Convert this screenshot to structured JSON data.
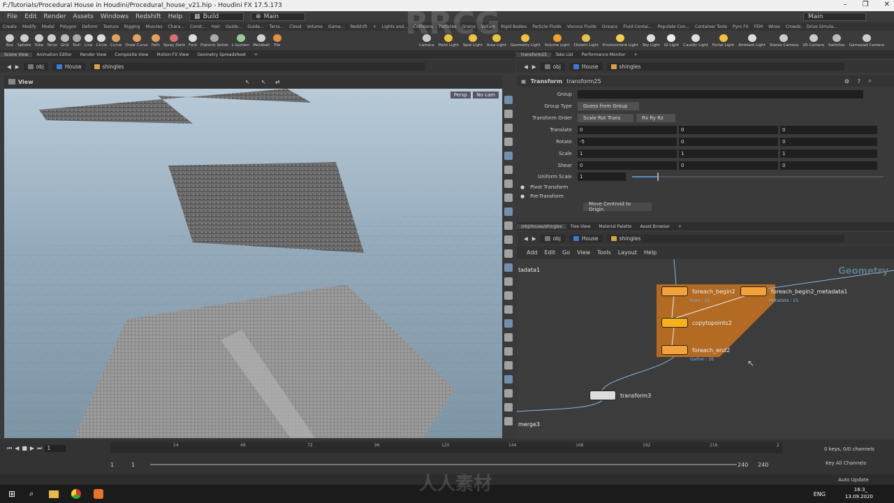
{
  "window": {
    "title": "F:/Tutorials/Procedural House in Houdini/Procedural_house_v21.hip - Houdini FX 17.5.173"
  },
  "menu": {
    "items": [
      "File",
      "Edit",
      "Render",
      "Assets",
      "Windows",
      "Redshift",
      "Help"
    ],
    "desktop": "Build",
    "desk": "Main",
    "right": "Main"
  },
  "shelf_tabs": [
    "Create",
    "Modify",
    "Model",
    "Polygon",
    "Deform",
    "Texture",
    "Rigging",
    "Muscles",
    "Chara...",
    "Const...",
    "Hair",
    "Guide...",
    "Guide...",
    "Terra...",
    "Cloud",
    "Volume",
    "Game...",
    "Redshift",
    "+",
    "Lights and...",
    "Collisions",
    "Particles",
    "Grains",
    "Vellum",
    "Rigid Bodies",
    "Particle Fluids",
    "Viscous Fluids",
    "Oceans",
    "Fluid Contai...",
    "Populate Con...",
    "Container Tools",
    "Pyro FX",
    "FEM",
    "Wires",
    "Crowds",
    "Drive Simula..."
  ],
  "shelf_tools_left": [
    "Box",
    "Sphere",
    "Tube",
    "Torus",
    "Grid",
    "Null",
    "Line",
    "Circle",
    "Curve",
    "Draw Curve",
    "Path",
    "Spray Paint",
    "Font",
    "Platonic Solids",
    "L-System",
    "Metaball",
    "File"
  ],
  "shelf_tools_right": [
    "Camera",
    "Point Light",
    "Spot Light",
    "Area Light",
    "Geometry Light",
    "Volume Light",
    "Distant Light",
    "Environment Light",
    "Sky Light",
    "GI Light",
    "Caustic Light",
    "Portal Light",
    "Ambient Light",
    "Stereo Camera",
    "VR Camera",
    "Switcher",
    "Gamepad Camera"
  ],
  "left_pane": {
    "tabs": [
      "Scene View",
      "Animation Editor",
      "Render View",
      "Composite View",
      "Motion FX View",
      "Geometry Spreadsheet",
      "+"
    ],
    "path": [
      "obj",
      "House",
      "shingles"
    ],
    "view_label": "View",
    "persp": "Persp",
    "cam": "No cam"
  },
  "param_pane": {
    "tabs": [
      "transform25",
      "Take List",
      "Performance Monitor",
      "+"
    ],
    "path": [
      "obj",
      "House",
      "shingles"
    ],
    "node_type": "Transform",
    "node_name": "transform25",
    "group_label": "Group",
    "group_value": "",
    "group_type_label": "Group Type",
    "group_type_value": "Guess from Group",
    "order_label": "Transform Order",
    "order_value": "Scale Rot Trans",
    "rot_order_value": "Rx Ry Rz",
    "translate_label": "Translate",
    "translate": [
      "0",
      "0",
      "0"
    ],
    "rotate_label": "Rotate",
    "rotate": [
      "-5",
      "0",
      "0"
    ],
    "scale_label": "Scale",
    "scale": [
      "1",
      "1",
      "1"
    ],
    "shear_label": "Shear",
    "shear": [
      "0",
      "0",
      "0"
    ],
    "uniform_label": "Uniform Scale",
    "uniform_value": "1",
    "pivot_label": "Pivot Transform",
    "pre_label": "Pre-Transform",
    "centroid_btn": "Move Centroid to Origin"
  },
  "net_pane": {
    "tabs": [
      "/obj/House/shingles",
      "Tree View",
      "Material Palette",
      "Asset Browser",
      "+"
    ],
    "path": [
      "obj",
      "House",
      "shingles"
    ],
    "menus": [
      "Add",
      "Edit",
      "Go",
      "View",
      "Tools",
      "Layout",
      "Help"
    ],
    "geometry_label": "Geometry",
    "nodes": {
      "tadata": "tadata1",
      "begin": "foreach_begin2",
      "begin_sub": "Point : 25",
      "meta": "foreach_begin2_metadata1",
      "meta_sub": "Metadata : 25",
      "copy": "copytopoints2",
      "end": "foreach_end2",
      "end_sub": "Gather : 26",
      "transform": "transform3",
      "merge": "merge3"
    }
  },
  "timeline": {
    "frame": "1",
    "ticks": [
      "24",
      "48",
      "72",
      "96",
      "120",
      "144",
      "168",
      "192",
      "216",
      "2"
    ],
    "start": "1",
    "start2": "1",
    "end": "240",
    "end2": "240",
    "keys": "0 keys, 0/0 channels",
    "key_all": "Key All Channels",
    "auto_update": "Auto Update"
  },
  "taskbar": {
    "lang": "ENG",
    "time": "16:3_",
    "date": "13.09.2020"
  },
  "watermarks": [
    "RRCG",
    "人人素材"
  ]
}
